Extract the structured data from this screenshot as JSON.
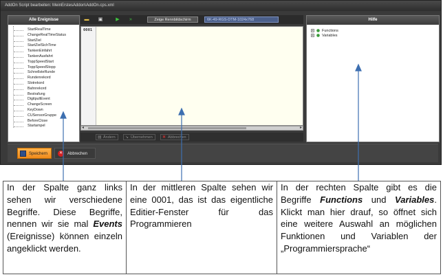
{
  "window": {
    "title": "AddOn Script bearbeiten: MeinErstesAddon\\AddOn.cps.xml"
  },
  "left_panel": {
    "header": "Alle Ereignisse",
    "events": [
      "StartRealTime",
      "ChangeRealTimeStatus",
      "StartZiel",
      "StartZielSichTime",
      "TankenEinfahrt",
      "TankenAusfahrt",
      "ToppSpeedStart",
      "ToppSpeedStopp",
      "SchnellsteRunde",
      "Rundenrekord",
      "Slotrekord",
      "Bahnrekord",
      "Bestrafung",
      "DigitpultEvent",
      "ChangeScreen",
      "KeyDown",
      "CUSensorGruppe",
      "BeforeClose",
      "Startampel"
    ]
  },
  "toolbar": {
    "show_button": "Zeige Rennbildschirm",
    "resolution_field": "6K-49-RGS-DTM-1024x768",
    "icons": [
      "folder-icon",
      "save-icon",
      "play-icon",
      "fast-forward-icon"
    ]
  },
  "editor": {
    "line_number": "0001",
    "content": ""
  },
  "edit_actions": {
    "change": "Ändern",
    "apply": "Übernehmen",
    "cancel": "Abbrechen"
  },
  "right_panel": {
    "header": "Hilfe",
    "tree": [
      {
        "label": "Functions",
        "icon": "plus-icon"
      },
      {
        "label": "Variables",
        "icon": "plus-icon"
      }
    ]
  },
  "bottom": {
    "save": "Speichern",
    "cancel": "Abbrechen"
  },
  "notes": {
    "left": {
      "before": "In der Spalte ganz links sehen wir verschiedene Begriffe. Diese Begriffe, nennen wir sie mal ",
      "bold": "Events",
      "after": " (Ereignisse) können einzeln angeklickt werden."
    },
    "middle": "In der mittleren Spalte sehen wir eine 0001, das ist das eigentliche Editier-Fenster für das Programmieren",
    "right": {
      "before": "In der rechten Spalte gibt es die Begriffe ",
      "bold1": "Functions",
      "mid": " und ",
      "bold2": "Variables",
      "after": ". Klickt man hier drauf, so öffnet sich eine weitere Auswahl an möglichen Funktionen und Variablen der „Programmiersprache“"
    }
  },
  "colors": {
    "window_bg": "#3a3a3a",
    "accent_orange": "#f08a1b",
    "cancel_red": "#d21f1f",
    "editor_bg": "#fffff0",
    "arrow_blue": "#3d6fb0"
  }
}
